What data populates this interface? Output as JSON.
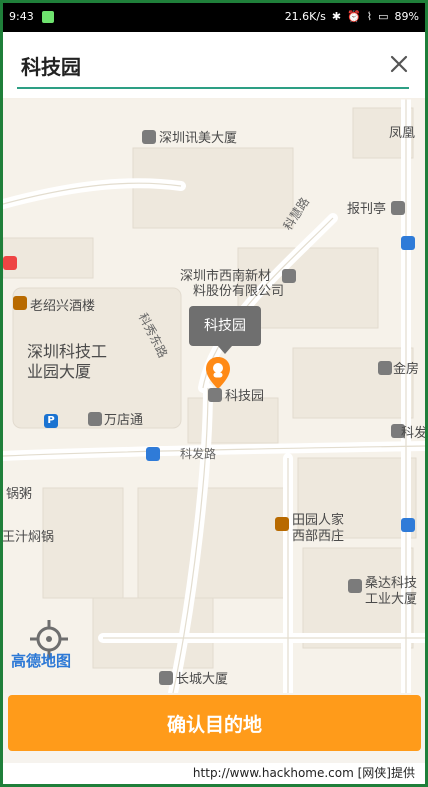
{
  "status": {
    "time": "9:43",
    "speed": "21.6K/s",
    "battery": "89%"
  },
  "search": {
    "value": "科技园"
  },
  "map": {
    "labels": {
      "top_right": "凤凰",
      "shenzhen_xunmei": "深圳讯美大厦",
      "baokanting": "报刊亭",
      "kehui_road": "科慧路",
      "xinan": "深圳市西南新材",
      "xinan2": "料股份有限公司",
      "laoshaoxing": "老绍兴酒楼",
      "kejiyuan_park": "深圳科技工",
      "kejiyuan_park2": "业园大厦",
      "kexiu_road": "科秀东路",
      "jinfang": "金房",
      "marker": "科技园",
      "wandian": "万店通",
      "kefa_road": "科发路",
      "kefa_road2": "科发",
      "guozhou": "锅粥",
      "zheshi": "王汁焖锅",
      "tianyuan": "田园人家",
      "xibu": "西部西庄",
      "sangda": "桑达科技",
      "sangda2": "工业大厦",
      "changcheng": "长城大厦",
      "brand": "高德地图",
      "watermark": "http://www.hackhome.com [网侠]提供"
    }
  },
  "confirm": {
    "label": "确认目的地"
  },
  "icons": {
    "close": "close-icon",
    "locate": "locator-icon",
    "pin": "location-pin-icon",
    "bus": "bus-icon",
    "poi": "poi-icon",
    "parking": "parking-icon"
  }
}
